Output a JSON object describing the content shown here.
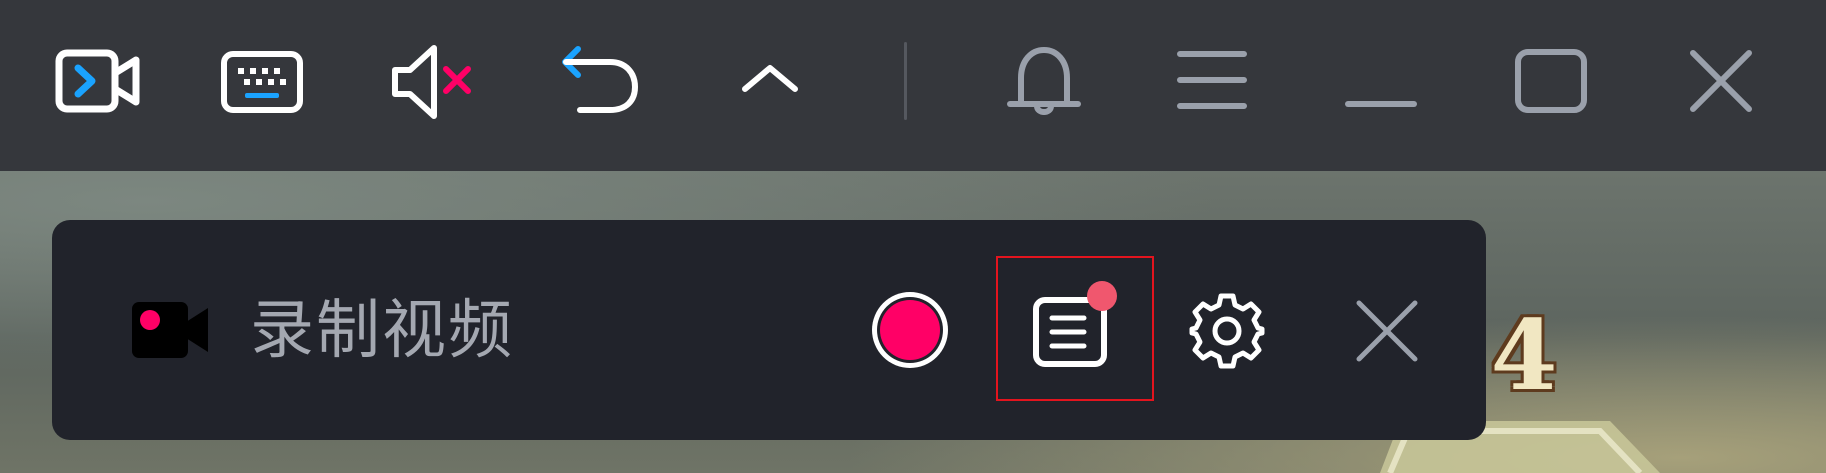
{
  "toolbar": {
    "icons": [
      "camera-record-icon",
      "keyboard-icon",
      "mute-icon",
      "undo-icon",
      "chevron-up-icon",
      "bell-icon",
      "menu-icon",
      "minimize-icon",
      "maximize-icon",
      "close-icon"
    ]
  },
  "recorder": {
    "title": "录制视频",
    "accent_color": "#ff0066"
  },
  "game": {
    "badge_text": "4"
  },
  "colors": {
    "toolbar_bg": "#35373c",
    "panel_bg": "#21232b",
    "icon_light": "#ffffff",
    "icon_muted": "#9aa0ab",
    "accent_blue": "#1aa3ff",
    "accent_red": "#ff0066",
    "highlight_border": "#e3141e"
  }
}
